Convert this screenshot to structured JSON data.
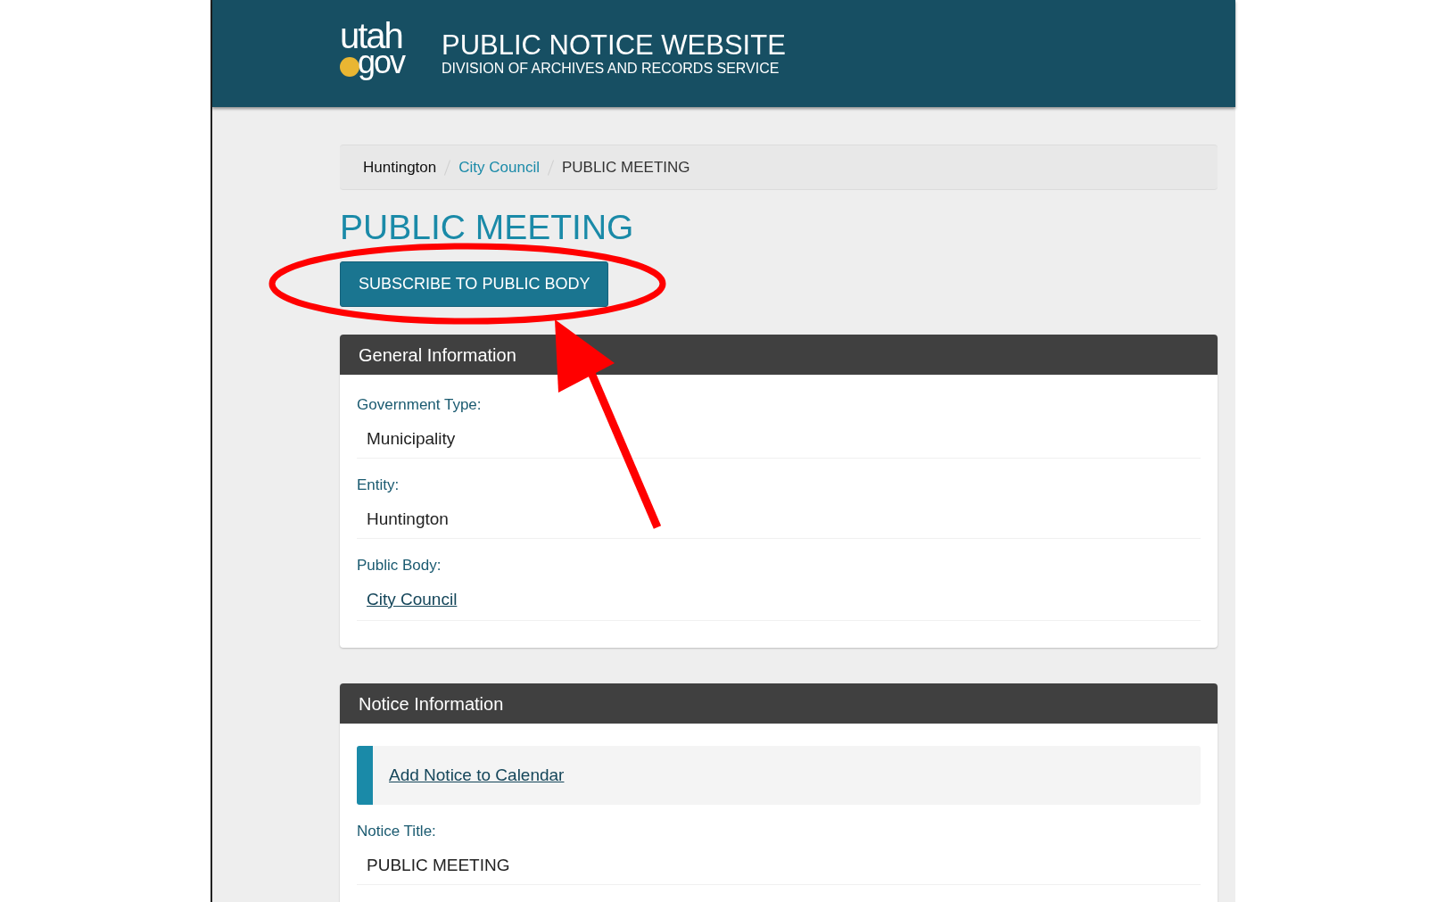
{
  "header": {
    "logo": {
      "top": "utah",
      "bottom": "gov"
    },
    "title": "PUBLIC NOTICE WEBSITE",
    "subtitle": "DIVISION OF ARCHIVES AND RECORDS SERVICE"
  },
  "breadcrumb": [
    {
      "label": "Huntington",
      "kind": "plain"
    },
    {
      "label": "City Council",
      "kind": "link"
    },
    {
      "label": "PUBLIC MEETING",
      "kind": "current"
    }
  ],
  "page_title": "PUBLIC MEETING",
  "subscribe_button": "SUBSCRIBE TO PUBLIC BODY",
  "panels": [
    {
      "heading": "General Information",
      "items": [
        {
          "kind": "field",
          "label": "Government Type:",
          "value": "Municipality",
          "link": false
        },
        {
          "kind": "field",
          "label": "Entity:",
          "value": "Huntington",
          "link": false
        },
        {
          "kind": "field",
          "label": "Public Body:",
          "value": "City Council",
          "link": true
        }
      ]
    },
    {
      "heading": "Notice Information",
      "items": [
        {
          "kind": "callout",
          "text": "Add Notice to Calendar"
        },
        {
          "kind": "field",
          "label": "Notice Title:",
          "value": "PUBLIC MEETING",
          "link": false
        }
      ]
    }
  ]
}
